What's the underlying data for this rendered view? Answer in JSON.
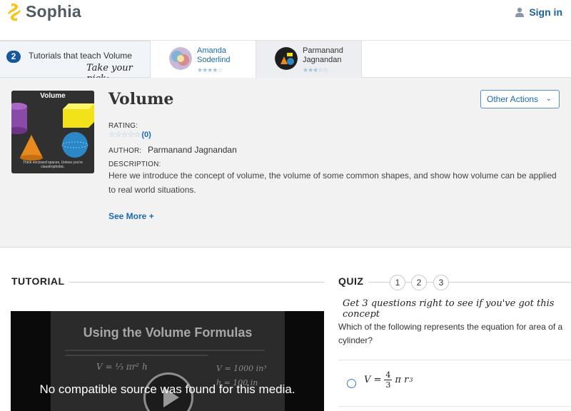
{
  "header": {
    "logo_text": "Sophia",
    "signin_label": "Sign in"
  },
  "tutorial_strip": {
    "count": "2",
    "title": "Tutorials that teach Volume",
    "take_pick": "Take your pick:",
    "tutorials": [
      {
        "name": "Amanda Soderlind",
        "rating": 4,
        "active": false
      },
      {
        "name": "Parmanand Jagnandan",
        "rating": 3,
        "active": true
      }
    ]
  },
  "tutorial_info": {
    "thumbnail_title": "Volume",
    "thumbnail_caption": "Think enclosed spaces. Unless you're claustrophobic.",
    "title": "Volume",
    "other_actions_label": "Other Actions",
    "rating_label": "RATING:",
    "rating_stars": "☆☆☆☆☆",
    "rating_count": "(0)",
    "author_label": "AUTHOR:",
    "author_name": "Parmanand Jagnandan",
    "description_label": "DESCRIPTION:",
    "description": "Here we introduce the concept of volume, the volume of some common shapes, and show how volume can be applied to real world situations.",
    "see_more_label": "See More +"
  },
  "tutorial_section": {
    "heading": "TUTORIAL",
    "video_frame_title": "Using the Volume Formulas",
    "video_message": "No compatible source was found for this media."
  },
  "quiz": {
    "heading": "QUIZ",
    "numbers": [
      "1",
      "2",
      "3"
    ],
    "prompt": "Get 3 questions right to see if you've got this concept",
    "question": "Which of the following represents the equation for area of a cylinder?",
    "answer": {
      "lhs": "V =",
      "num": "4",
      "den": "3",
      "rhs": "π r",
      "exp": "3"
    }
  },
  "colors": {
    "brand_blue": "#1a5f9e",
    "link_blue": "#1a6ab3",
    "logo_yellow": "#f5c518",
    "badge_blue": "#16579f"
  },
  "icons": [
    "sophia-logo-icon",
    "user-icon",
    "chevron-down-icon",
    "play-icon"
  ]
}
